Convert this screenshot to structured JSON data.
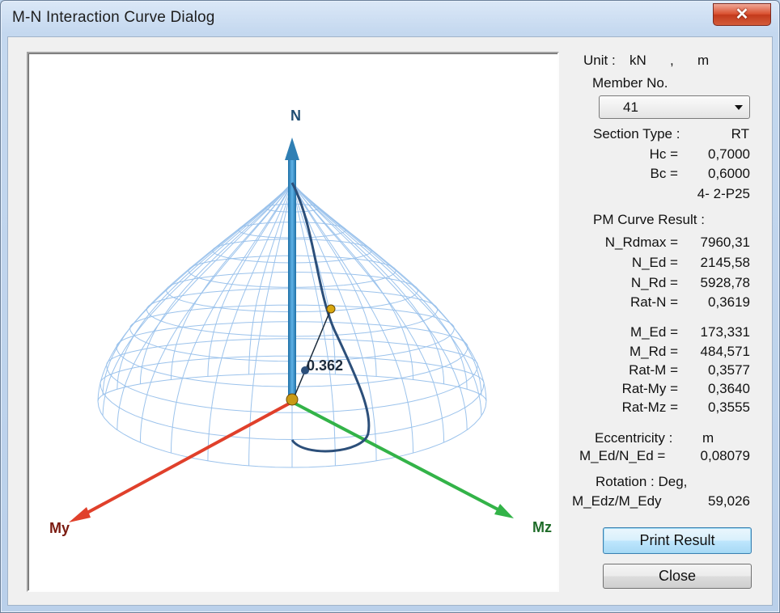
{
  "window": {
    "title": "M-N Interaction Curve Dialog",
    "close_glyph": "✕"
  },
  "viewport": {
    "axis_n": "N",
    "axis_my": "My",
    "axis_mz": "Mz",
    "ratio_label": "0.362",
    "colors": {
      "mesh": "#9cc3ec",
      "n_axis": "#2f7fb4",
      "my_axis": "#e0402b",
      "mz_axis": "#33b348",
      "curve": "#2c4f7a",
      "point": "#c99a16"
    }
  },
  "panel": {
    "unit_label": "Unit :",
    "unit_force": "kN",
    "unit_sep": ",",
    "unit_length": "m",
    "member_no_label": "Member No.",
    "member_no_value": "41",
    "section_type_label": "Section Type :",
    "section_type_value": "RT",
    "section": [
      {
        "label": "Hc =",
        "value": "0,7000"
      },
      {
        "label": "Bc =",
        "value": "0,6000"
      }
    ],
    "rebar": "4- 2-P25",
    "pm_header": "PM Curve Result :",
    "pm_n": [
      {
        "label": "N_Rdmax =",
        "value": "7960,31"
      },
      {
        "label": "N_Ed =",
        "value": "2145,58"
      },
      {
        "label": "N_Rd =",
        "value": "5928,78"
      },
      {
        "label": "Rat-N =",
        "value": "0,3619"
      }
    ],
    "pm_m": [
      {
        "label": "M_Ed =",
        "value": "173,331"
      },
      {
        "label": "M_Rd =",
        "value": "484,571"
      },
      {
        "label": "Rat-M =",
        "value": "0,3577"
      },
      {
        "label": "Rat-My =",
        "value": "0,3640"
      },
      {
        "label": "Rat-Mz =",
        "value": "0,3555"
      }
    ],
    "ecc_label": "Eccentricity :",
    "ecc_unit": "m",
    "ecc_key": "M_Ed/N_Ed =",
    "ecc_value": "0,08079",
    "rot_label": "Rotation : Deg,",
    "rot_key": "M_Edz/M_Edy",
    "rot_value": "59,026",
    "print_button": "Print Result",
    "close_button": "Close"
  }
}
